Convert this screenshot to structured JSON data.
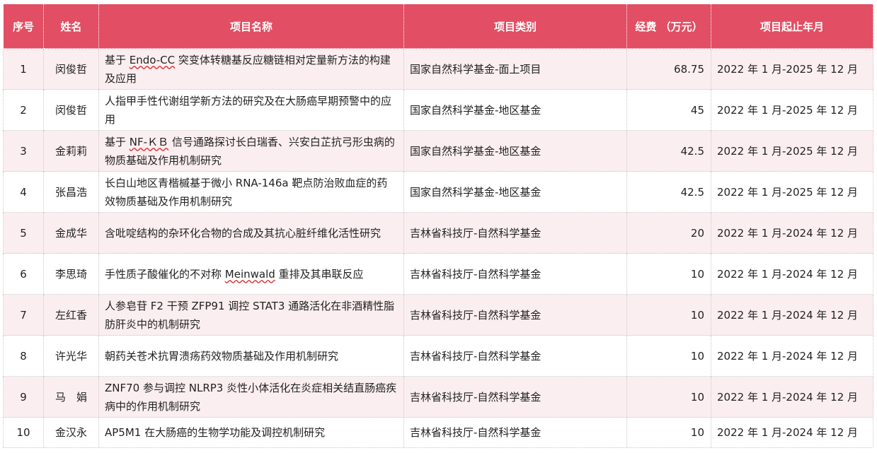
{
  "headers": {
    "idx": "序号",
    "name": "姓名",
    "title": "项目名称",
    "category": "项目类别",
    "fund": "经费 （万元）",
    "period": "项目起止年月"
  },
  "rows": [
    {
      "idx": "1",
      "name": "闵俊哲",
      "title_pre": "基于 ",
      "title_mark": "Endo-CC",
      "title_post": " 突变体转糖基反应糖链相对定量新方法的构建及应用",
      "category": "国家自然科学基金-面上项目",
      "fund": "68.75",
      "period": "2022 年 1 月-2025 年 12 月"
    },
    {
      "idx": "2",
      "name": "闵俊哲",
      "title_pre": "人指甲手性代谢组学新方法的研究及在大肠癌早期预警中的应用",
      "title_mark": "",
      "title_post": "",
      "category": "国家自然科学基金-地区基金",
      "fund": "45",
      "period": "2022 年 1 月-2025 年 12 月"
    },
    {
      "idx": "3",
      "name": "金莉莉",
      "title_pre": "基于 ",
      "title_mark": "NF-ＫＢ",
      "title_post": " 信号通路探讨长白瑞香、兴安白芷抗弓形虫病的物质基础及作用机制研究",
      "category": "国家自然科学基金-地区基金",
      "fund": "42.5",
      "period": "2022 年 1 月-2025 年 12 月"
    },
    {
      "idx": "4",
      "name": "张昌浩",
      "title_pre": "长白山地区青楷槭基于微小 RNA-146a 靶点防治败血症的药效物质基础及作用机制研究",
      "title_mark": "",
      "title_post": "",
      "category": "国家自然科学基金-地区基金",
      "fund": "42.5",
      "period": "2022 年 1 月-2025 年 12 月"
    },
    {
      "idx": "5",
      "name": "金成华",
      "title_pre": "含吡啶结构的杂环化合物的合成及其抗心脏纤维化活性研究",
      "title_mark": "",
      "title_post": "",
      "category": "吉林省科技厅-自然科学基金",
      "fund": "20",
      "period": "2022 年 1 月-2024 年 12 月"
    },
    {
      "idx": "6",
      "name": "李思琦",
      "title_pre": "手性质子酸催化的不对称 ",
      "title_mark": "Meinwald",
      "title_post": " 重排及其串联反应",
      "category": "吉林省科技厅-自然科学基金",
      "fund": "10",
      "period": "2022 年 1 月-2024 年 12 月"
    },
    {
      "idx": "7",
      "name": "左红香",
      "title_pre": "人参皂苷 F2 干预 ZFP91 调控 STAT3 通路活化在非酒精性脂肪肝炎中的机制研究",
      "title_mark": "",
      "title_post": "",
      "category": "吉林省科技厅-自然科学基金",
      "fund": "10",
      "period": "2022 年 1 月-2024 年 12 月"
    },
    {
      "idx": "8",
      "name": "许光华",
      "title_pre": "朝药关苍术抗胃溃疡药效物质基础及作用机制研究",
      "title_mark": "",
      "title_post": "",
      "category": "吉林省科技厅-自然科学基金",
      "fund": "10",
      "period": "2022 年 1 月-2024 年 12 月"
    },
    {
      "idx": "9",
      "name": "马　娟",
      "title_pre": "ZNF70 参与调控 NLRP3 炎性小体活化在炎症相关结直肠癌疾病中的作用机制研究",
      "title_mark": "",
      "title_post": "",
      "category": "吉林省科技厅-自然科学基金",
      "fund": "10",
      "period": "2022 年 1 月-2024 年 12 月"
    },
    {
      "idx": "10",
      "name": "金汉永",
      "title_pre": "AP5M1 在大肠癌的生物学功能及调控机制研究",
      "title_mark": "",
      "title_post": "",
      "category": "吉林省科技厅-自然科学基金",
      "fund": "10",
      "period": "2022 年 1 月-2024 年 12 月"
    }
  ],
  "colors": {
    "header_bg": "#e24e63",
    "header_text": "#ffffff",
    "row_odd_bg": "#fbeef0",
    "row_even_bg": "#ffffff",
    "spell_underline": "#d93a3a"
  }
}
